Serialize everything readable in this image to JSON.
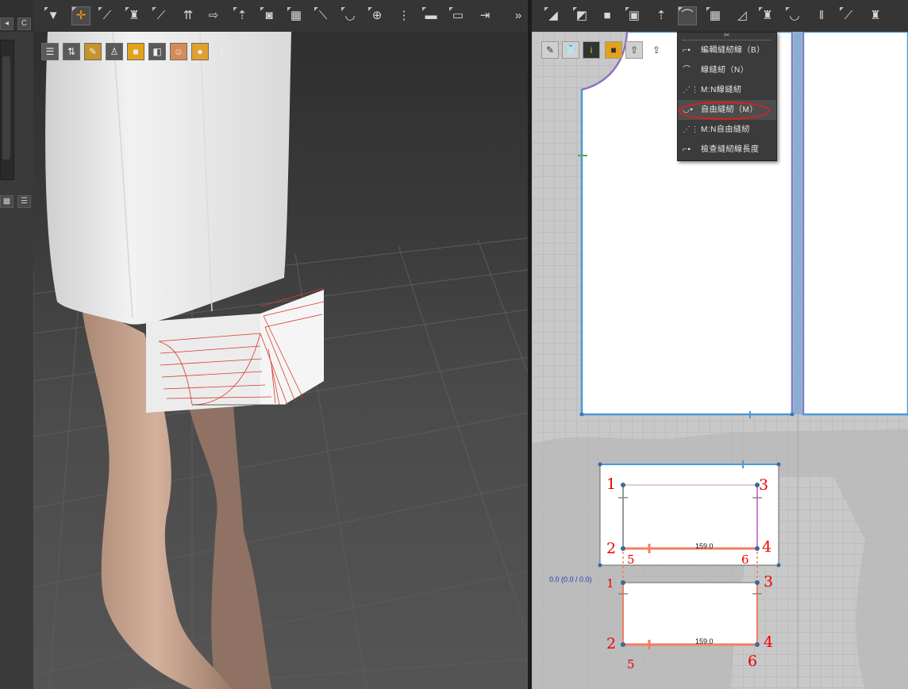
{
  "left_strip": {
    "top_buttons": [
      "◂",
      "C"
    ],
    "lower_buttons": [
      "▦",
      "☰"
    ]
  },
  "toolbar_3d": {
    "icons": [
      "down-arrow-icon",
      "move-icon",
      "select-mesh-icon",
      "tshirt-select-icon",
      "pin-icon",
      "fold-icon",
      "tack-icon",
      "avatar-arrange-icon",
      "arrange-point-icon",
      "grid-icon",
      "sewing-icon",
      "measure-icon",
      "button-icon",
      "zipper-icon",
      "topstitch-icon",
      "piping-icon",
      "gather-icon"
    ],
    "overflow": "»"
  },
  "toolbar_2d": {
    "icons": [
      "transform-pattern-icon",
      "edit-pattern-icon",
      "rectangle-icon",
      "internal-rectangle-icon",
      "trace-icon",
      "segment-sewing-icon",
      "grid-icon",
      "fold-arrange-icon",
      "tshirt-icon",
      "free-sewing-icon",
      "pleat-icon",
      "edit-curve-icon",
      "tshirt-outline-icon"
    ]
  },
  "viewport3d_tools": [
    "☰",
    "⇅",
    "✎",
    "♙",
    "■",
    "◧",
    "☺",
    "●",
    "⇪"
  ],
  "viewport2d_tools": [
    "✎",
    "👕",
    "i",
    "■",
    "⇧",
    "⇪"
  ],
  "sew_menu": {
    "tearoff": "✂",
    "items": [
      {
        "label": "編輯縫紉線（B）",
        "icon": "edit-sewing-icon"
      },
      {
        "label": "線縫紉（N）",
        "icon": "segment-sewing-icon"
      },
      {
        "label": "M:N線縫紉",
        "icon": "mn-segment-sewing-icon"
      },
      {
        "label": "自由縫紉（M）",
        "icon": "free-sewing-icon",
        "selected": true
      },
      {
        "label": "M:N自由縫紉",
        "icon": "mn-free-sewing-icon"
      },
      {
        "label": "檢查縫紉線長度",
        "icon": "check-length-icon"
      }
    ]
  },
  "annotations": {
    "top_piece": [
      "1",
      "2",
      "3",
      "4",
      "5",
      "6"
    ],
    "bottom_piece": [
      "1",
      "2",
      "3",
      "4",
      "5",
      "6"
    ]
  },
  "measurements": {
    "top_length": "159.0",
    "bottom_length": "159.0",
    "coord_readout": "0.0 (0.0 / 0.0)"
  }
}
